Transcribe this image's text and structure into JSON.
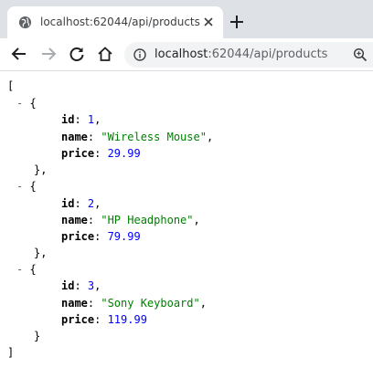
{
  "browser": {
    "tab_title": "localhost:62044/api/products",
    "url_host": "localhost",
    "url_rest": ":62044/api/products"
  },
  "json_view": {
    "open_bracket": "[",
    "close_bracket": "]",
    "toggle": "-",
    "products": [
      {
        "id": "1",
        "name": "\"Wireless Mouse\"",
        "price": "29.99"
      },
      {
        "id": "2",
        "name": "\"HP Headphone\"",
        "price": "79.99"
      },
      {
        "id": "3",
        "name": "\"Sony Keyboard\"",
        "price": "119.99"
      }
    ],
    "keys": {
      "id": "id",
      "name": "name",
      "price": "price"
    }
  },
  "colors": {
    "string": "#008000",
    "number": "#0000ff",
    "tab_strip": "#dee1e6",
    "omnibox": "#f1f3f4"
  }
}
